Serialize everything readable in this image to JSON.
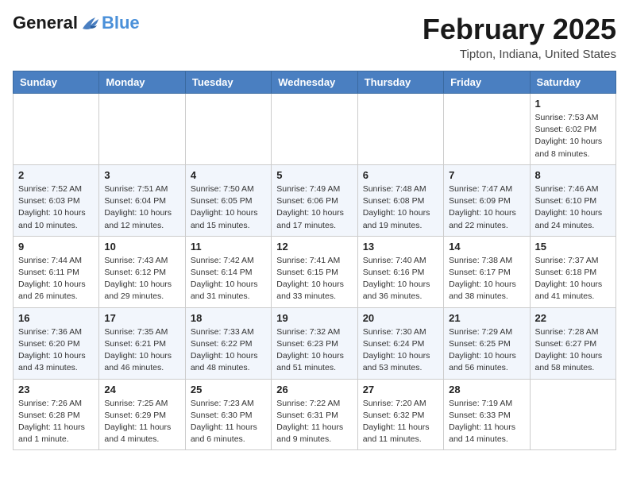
{
  "header": {
    "logo_general": "General",
    "logo_blue": "Blue",
    "month_title": "February 2025",
    "location": "Tipton, Indiana, United States"
  },
  "days_of_week": [
    "Sunday",
    "Monday",
    "Tuesday",
    "Wednesday",
    "Thursday",
    "Friday",
    "Saturday"
  ],
  "weeks": [
    {
      "days": [
        {
          "date": "",
          "info": ""
        },
        {
          "date": "",
          "info": ""
        },
        {
          "date": "",
          "info": ""
        },
        {
          "date": "",
          "info": ""
        },
        {
          "date": "",
          "info": ""
        },
        {
          "date": "",
          "info": ""
        },
        {
          "date": "1",
          "info": "Sunrise: 7:53 AM\nSunset: 6:02 PM\nDaylight: 10 hours and 8 minutes."
        }
      ]
    },
    {
      "days": [
        {
          "date": "2",
          "info": "Sunrise: 7:52 AM\nSunset: 6:03 PM\nDaylight: 10 hours and 10 minutes."
        },
        {
          "date": "3",
          "info": "Sunrise: 7:51 AM\nSunset: 6:04 PM\nDaylight: 10 hours and 12 minutes."
        },
        {
          "date": "4",
          "info": "Sunrise: 7:50 AM\nSunset: 6:05 PM\nDaylight: 10 hours and 15 minutes."
        },
        {
          "date": "5",
          "info": "Sunrise: 7:49 AM\nSunset: 6:06 PM\nDaylight: 10 hours and 17 minutes."
        },
        {
          "date": "6",
          "info": "Sunrise: 7:48 AM\nSunset: 6:08 PM\nDaylight: 10 hours and 19 minutes."
        },
        {
          "date": "7",
          "info": "Sunrise: 7:47 AM\nSunset: 6:09 PM\nDaylight: 10 hours and 22 minutes."
        },
        {
          "date": "8",
          "info": "Sunrise: 7:46 AM\nSunset: 6:10 PM\nDaylight: 10 hours and 24 minutes."
        }
      ]
    },
    {
      "days": [
        {
          "date": "9",
          "info": "Sunrise: 7:44 AM\nSunset: 6:11 PM\nDaylight: 10 hours and 26 minutes."
        },
        {
          "date": "10",
          "info": "Sunrise: 7:43 AM\nSunset: 6:12 PM\nDaylight: 10 hours and 29 minutes."
        },
        {
          "date": "11",
          "info": "Sunrise: 7:42 AM\nSunset: 6:14 PM\nDaylight: 10 hours and 31 minutes."
        },
        {
          "date": "12",
          "info": "Sunrise: 7:41 AM\nSunset: 6:15 PM\nDaylight: 10 hours and 33 minutes."
        },
        {
          "date": "13",
          "info": "Sunrise: 7:40 AM\nSunset: 6:16 PM\nDaylight: 10 hours and 36 minutes."
        },
        {
          "date": "14",
          "info": "Sunrise: 7:38 AM\nSunset: 6:17 PM\nDaylight: 10 hours and 38 minutes."
        },
        {
          "date": "15",
          "info": "Sunrise: 7:37 AM\nSunset: 6:18 PM\nDaylight: 10 hours and 41 minutes."
        }
      ]
    },
    {
      "days": [
        {
          "date": "16",
          "info": "Sunrise: 7:36 AM\nSunset: 6:20 PM\nDaylight: 10 hours and 43 minutes."
        },
        {
          "date": "17",
          "info": "Sunrise: 7:35 AM\nSunset: 6:21 PM\nDaylight: 10 hours and 46 minutes."
        },
        {
          "date": "18",
          "info": "Sunrise: 7:33 AM\nSunset: 6:22 PM\nDaylight: 10 hours and 48 minutes."
        },
        {
          "date": "19",
          "info": "Sunrise: 7:32 AM\nSunset: 6:23 PM\nDaylight: 10 hours and 51 minutes."
        },
        {
          "date": "20",
          "info": "Sunrise: 7:30 AM\nSunset: 6:24 PM\nDaylight: 10 hours and 53 minutes."
        },
        {
          "date": "21",
          "info": "Sunrise: 7:29 AM\nSunset: 6:25 PM\nDaylight: 10 hours and 56 minutes."
        },
        {
          "date": "22",
          "info": "Sunrise: 7:28 AM\nSunset: 6:27 PM\nDaylight: 10 hours and 58 minutes."
        }
      ]
    },
    {
      "days": [
        {
          "date": "23",
          "info": "Sunrise: 7:26 AM\nSunset: 6:28 PM\nDaylight: 11 hours and 1 minute."
        },
        {
          "date": "24",
          "info": "Sunrise: 7:25 AM\nSunset: 6:29 PM\nDaylight: 11 hours and 4 minutes."
        },
        {
          "date": "25",
          "info": "Sunrise: 7:23 AM\nSunset: 6:30 PM\nDaylight: 11 hours and 6 minutes."
        },
        {
          "date": "26",
          "info": "Sunrise: 7:22 AM\nSunset: 6:31 PM\nDaylight: 11 hours and 9 minutes."
        },
        {
          "date": "27",
          "info": "Sunrise: 7:20 AM\nSunset: 6:32 PM\nDaylight: 11 hours and 11 minutes."
        },
        {
          "date": "28",
          "info": "Sunrise: 7:19 AM\nSunset: 6:33 PM\nDaylight: 11 hours and 14 minutes."
        },
        {
          "date": "",
          "info": ""
        }
      ]
    }
  ]
}
